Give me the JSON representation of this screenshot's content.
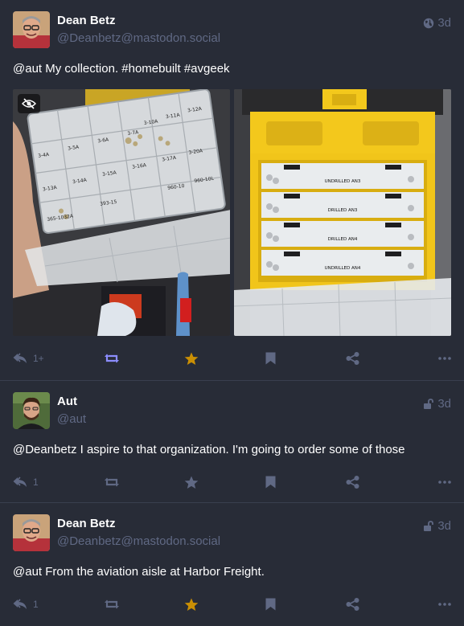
{
  "colors": {
    "background": "#282c37",
    "muted": "#606984",
    "boost_active": "#8c8dff",
    "favourite_active": "#ca8f04",
    "divider": "#393f4f"
  },
  "posts": [
    {
      "display_name": "Dean Betz",
      "acct": "@Deanbetz@mastodon.social",
      "visibility_icon": "globe-icon",
      "time": "3d",
      "content": "@aut My collection. #homebuilt #avgeek",
      "media": [
        {
          "kind": "photo",
          "subject": "clear plastic organizer with labeled compartments"
        },
        {
          "kind": "photo",
          "subject": "yellow tool box with drawers",
          "labels": [
            "UNDRILLED AN3",
            "DRILLED AN3",
            "DRILLED AN4",
            "UNDRILLED AN4"
          ]
        }
      ],
      "organizer_labels": [
        "3-4A",
        "3-5A",
        "3-6A",
        "3-7A",
        "3-10A",
        "3-11A",
        "3-12A",
        "3-13A",
        "3-14A",
        "3-15A",
        "3-16A",
        "3-17A",
        "3-20A",
        "365-1032A",
        "393-15",
        "960-10",
        "960-10L"
      ],
      "reply_count": "1+",
      "boosted": true,
      "favourited": true
    },
    {
      "display_name": "Aut",
      "acct": "@aut",
      "visibility_icon": "unlock-icon",
      "time": "3d",
      "content": "@Deanbetz I aspire to that organization. I'm going to order some of those",
      "reply_count": "1",
      "boosted": false,
      "favourited": false
    },
    {
      "display_name": "Dean Betz",
      "acct": "@Deanbetz@mastodon.social",
      "visibility_icon": "unlock-icon",
      "time": "3d",
      "content": "@aut From the aviation aisle at Harbor Freight.",
      "reply_count": "1",
      "boosted": false,
      "favourited": true
    }
  ]
}
